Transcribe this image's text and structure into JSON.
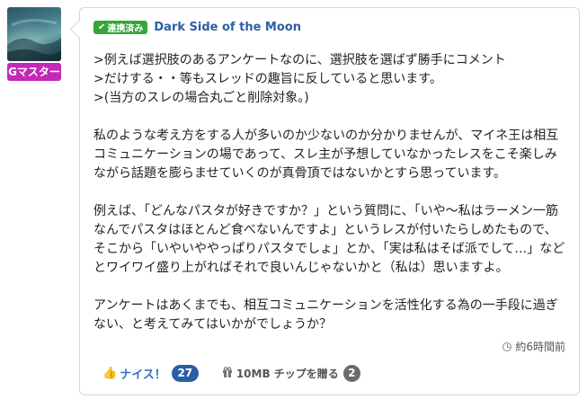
{
  "author": {
    "badge_label": "Gマスター",
    "verified_label": "連携済み",
    "username": "Dark Side of the Moon"
  },
  "post": {
    "quote_lines": [
      ">例えば選択肢のあるアンケートなのに、選択肢を選ばず勝手にコメント",
      ">だけする・・等もスレッドの趣旨に反していると思います。",
      ">(当方のスレの場合丸ごと削除対象。)"
    ],
    "paragraphs": [
      "私のような考え方をする人が多いのか少ないのか分かりませんが、マイネ王は相互コミュニケーションの場であって、スレ主が予想していなかったレスをこそ楽しみながら話題を膨らませていくのが真骨頂ではないかとすら思っています。",
      "例えば、「どんなパスタが好きですか？」という質問に、「いや〜私はラーメン一筋なんでパスタはほとんど食べないんですよ」というレスが付いたらしめたもので、そこから「いやいややっぱりパスタでしょ」とか、「実は私はそば派でして…」などとワイワイ盛り上がればそれで良いんじゃないかと（私は）思いますよ。",
      "アンケートはあくまでも、相互コミュニケーションを活性化する為の一手段に過ぎない、と考えてみてはいかがでしょうか？"
    ],
    "timestamp": "約6時間前"
  },
  "actions": {
    "nice_label": "ナイス！",
    "nice_count": "27",
    "tip_label": "10MB チップを贈る",
    "tip_count": "2"
  },
  "icons": {
    "thumb": "thumbs-up-icon",
    "gift": "gift-icon",
    "clock": "clock-icon",
    "check": "check-icon"
  }
}
